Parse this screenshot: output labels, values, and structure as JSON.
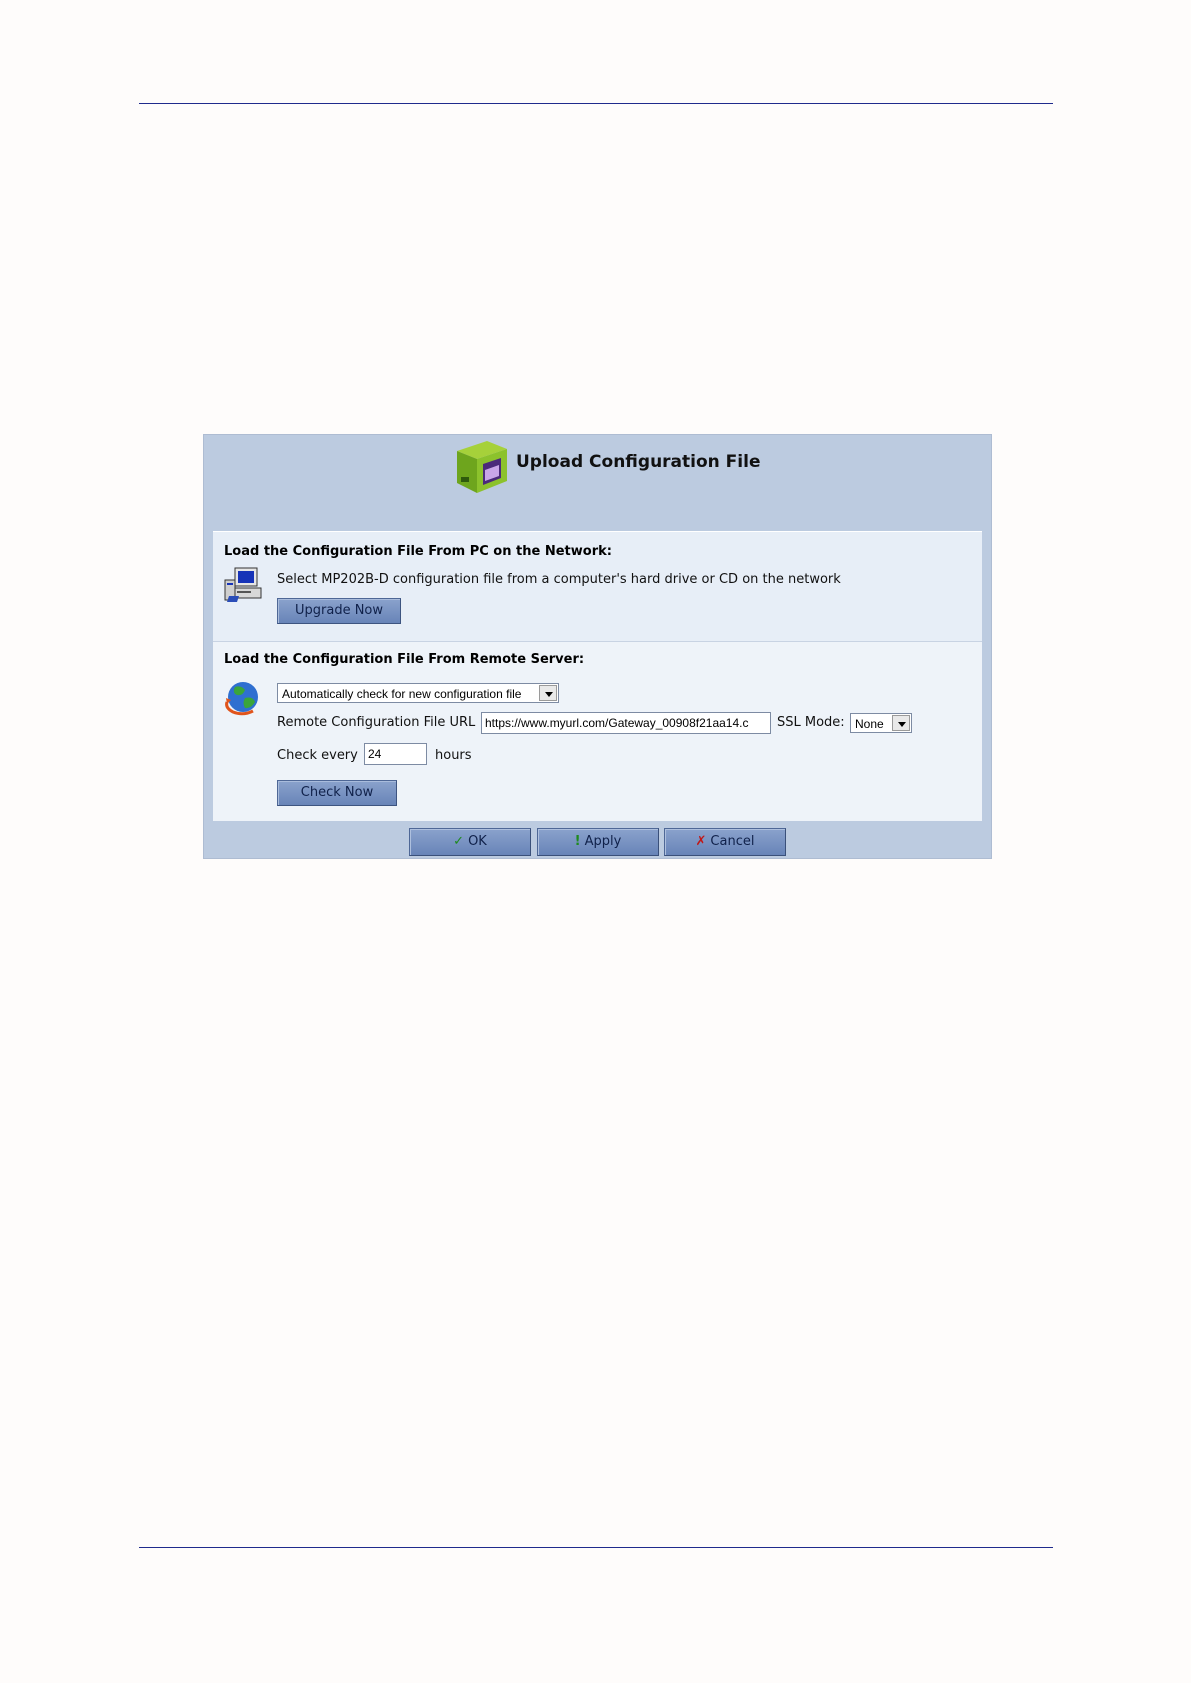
{
  "dialog": {
    "title": "Upload Configuration File",
    "icon": "upload-config-box-icon"
  },
  "pc_section": {
    "title": "Load the Configuration File From PC on the Network:",
    "icon": "computer-icon",
    "description": "Select MP202B-D configuration file from a computer's hard drive or CD on the network",
    "upgrade_button": "Upgrade Now"
  },
  "remote_section": {
    "title": "Load the Configuration File From Remote Server:",
    "icon": "globe-icon",
    "mode_select": "Automatically check for new configuration file",
    "url_label": "Remote Configuration File URL",
    "url_value": "https://www.myurl.com/Gateway_00908f21aa14.c",
    "ssl_label": "SSL Mode:",
    "ssl_value": "None",
    "check_every_label": "Check every",
    "check_every_value": "24",
    "hours_label": "hours",
    "check_button": "Check Now"
  },
  "footer": {
    "ok": {
      "glyph": "✓",
      "label": "OK",
      "color": "#1e8a1e"
    },
    "apply": {
      "glyph": "!",
      "label": "Apply",
      "color": "#1e8a1e"
    },
    "cancel": {
      "glyph": "✗",
      "label": "Cancel",
      "color": "#c01818"
    }
  }
}
